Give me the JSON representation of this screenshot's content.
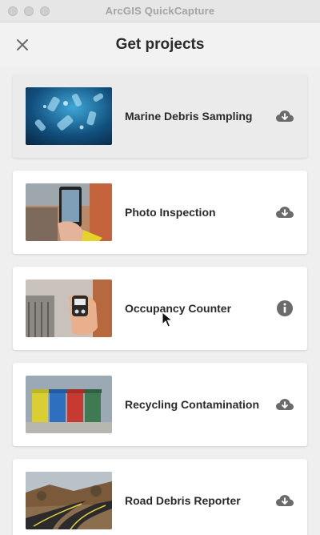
{
  "window": {
    "title": "ArcGIS QuickCapture"
  },
  "header": {
    "title": "Get projects",
    "close_icon": "close-icon"
  },
  "projects": [
    {
      "name": "Marine Debris Sampling",
      "action_icon": "cloud-download-icon",
      "hovered": true
    },
    {
      "name": "Photo Inspection",
      "action_icon": "cloud-download-icon",
      "hovered": false
    },
    {
      "name": "Occupancy Counter",
      "action_icon": "info-icon",
      "hovered": false
    },
    {
      "name": "Recycling Contamination",
      "action_icon": "cloud-download-icon",
      "hovered": false
    },
    {
      "name": "Road Debris Reporter",
      "action_icon": "cloud-download-icon",
      "hovered": false
    }
  ],
  "colors": {
    "icon": "#6b6b6b",
    "background": "#efefef",
    "card": "#ffffff",
    "card_hover": "#ebebeb"
  }
}
